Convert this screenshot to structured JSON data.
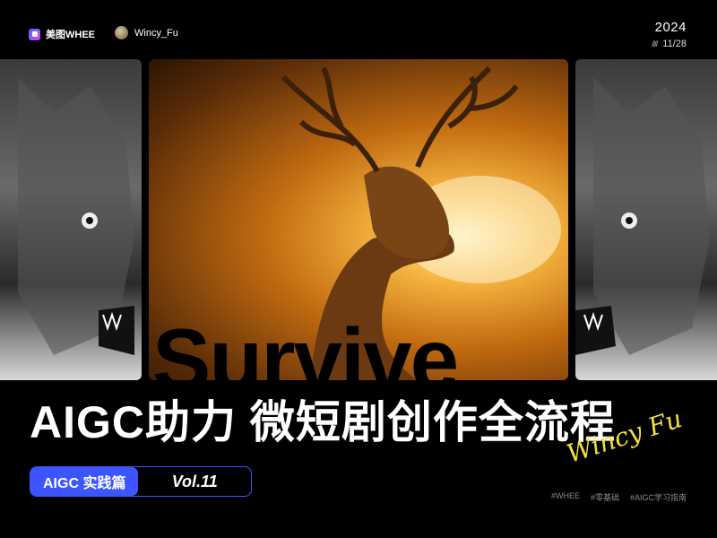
{
  "brand": {
    "name": "美图WHEE",
    "logo_icon": "whee-logo-icon"
  },
  "author": {
    "name": "Wincy_Fu"
  },
  "date": {
    "year": "2024",
    "day": "11/28",
    "decor": "////"
  },
  "hero": {
    "overlay_word": "Survive"
  },
  "headline": "AIGC助力 微短剧创作全流程",
  "series": {
    "tag": "AIGC 实践篇",
    "vol": "Vol.11"
  },
  "signature": "Wincy Fu",
  "hashtags": [
    "#WHEE",
    "#零基础",
    "#AIGC学习指南"
  ],
  "colors": {
    "accent": "#3c55ff",
    "signature": "#f5e03a",
    "background": "#000000"
  }
}
